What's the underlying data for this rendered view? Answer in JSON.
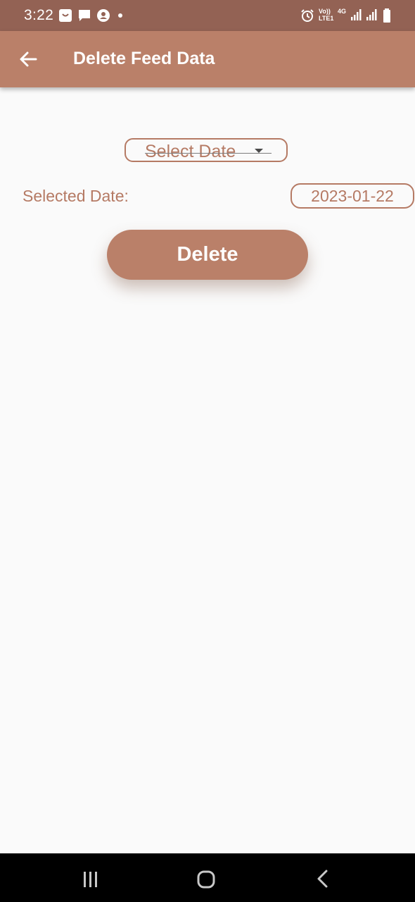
{
  "status_bar": {
    "time": "3:22",
    "network_label": "Vo))\nLTE1",
    "network_type": "4G",
    "icons": [
      "notification-icon",
      "message-icon",
      "account-icon",
      "dot-icon",
      "alarm-icon",
      "signal-icon",
      "signal-icon",
      "battery-icon"
    ]
  },
  "app_bar": {
    "title": "Delete Feed Data",
    "back_icon": "arrow-back-icon"
  },
  "select_date": {
    "label": "Select Date",
    "icon": "dropdown-arrow-icon"
  },
  "selected_date": {
    "label": "Selected Date:",
    "value": "2023-01-22"
  },
  "delete_button": {
    "label": "Delete"
  },
  "colors": {
    "status_bar": "#936254",
    "app_bar": "#ba8069",
    "accent_text": "#b57a64",
    "background": "#fafafa",
    "nav_bar": "#000000"
  },
  "nav_bar": {
    "icons": [
      "recents-icon",
      "home-icon",
      "back-icon"
    ]
  }
}
